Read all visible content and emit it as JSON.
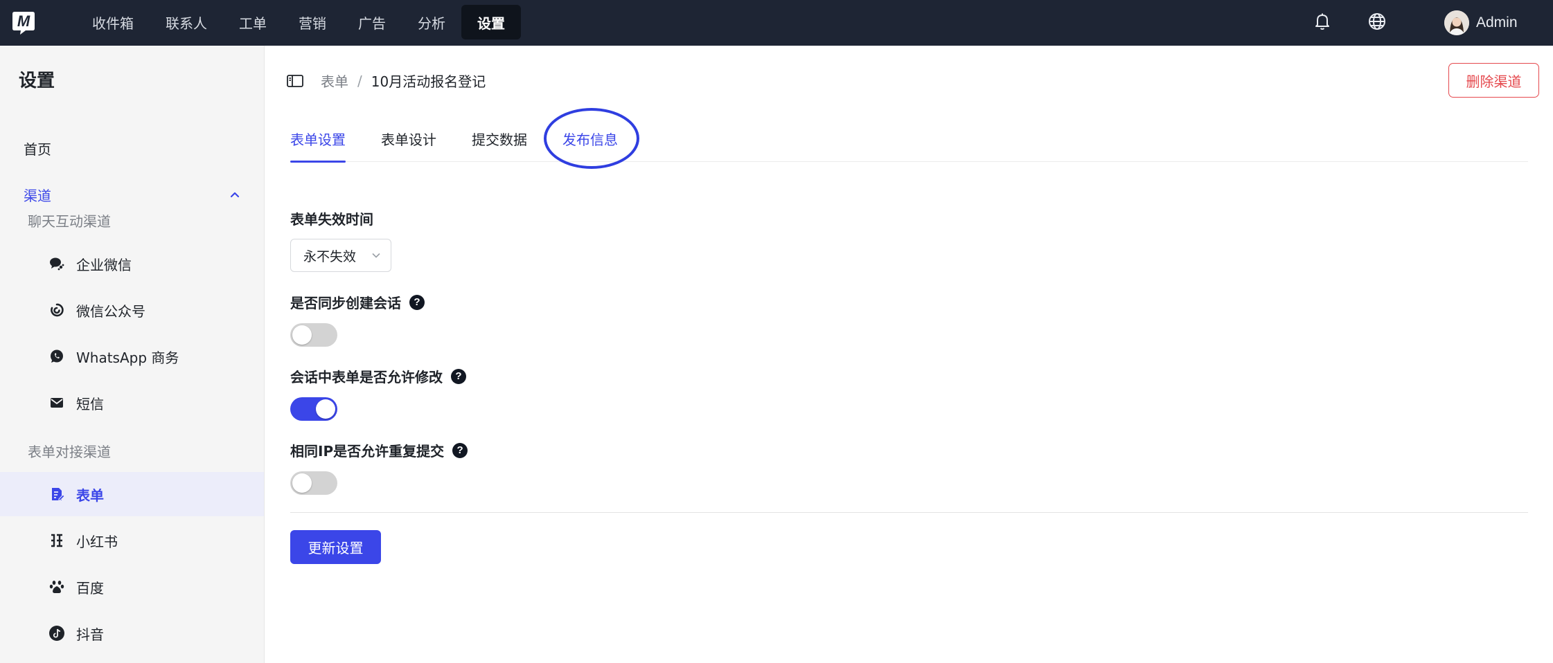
{
  "topbar": {
    "logo_letter": "M",
    "nav": [
      "收件箱",
      "联系人",
      "工单",
      "营销",
      "广告",
      "分析",
      "设置"
    ],
    "active_nav": "设置",
    "user_name": "Admin",
    "icons": [
      "bell-icon",
      "globe-icon"
    ]
  },
  "sidebar": {
    "title": "设置",
    "home": "首页",
    "channels": "渠道",
    "group_chat": "聊天互动渠道",
    "wecom": "企业微信",
    "wechat_official": "微信公众号",
    "whatsapp": "WhatsApp 商务",
    "sms": "短信",
    "group_form": "表单对接渠道",
    "form": "表单",
    "xiaohongshu": "小红书",
    "baidu": "百度",
    "douyin": "抖音",
    "active_item": "表单"
  },
  "main": {
    "breadcrumb": {
      "parent": "表单",
      "separator": "/",
      "current": "10月活动报名登记"
    },
    "delete_button": "删除渠道",
    "tabs": [
      "表单设置",
      "表单设计",
      "提交数据",
      "发布信息"
    ],
    "active_tab": "表单设置",
    "circled_tab": "发布信息",
    "fields": {
      "expire_label": "表单失效时间",
      "expire_value": "永不失效",
      "sync_session_label": "是否同步创建会话",
      "sync_session_on": false,
      "allow_edit_label": "会话中表单是否允许修改",
      "allow_edit_on": true,
      "dup_ip_label": "相同IP是否允许重复提交",
      "dup_ip_on": false,
      "help_glyph": "?"
    },
    "submit_button": "更新设置"
  },
  "colors": {
    "accent": "#3b46e8",
    "topbar": "#1e2534",
    "danger": "#e5484d"
  }
}
